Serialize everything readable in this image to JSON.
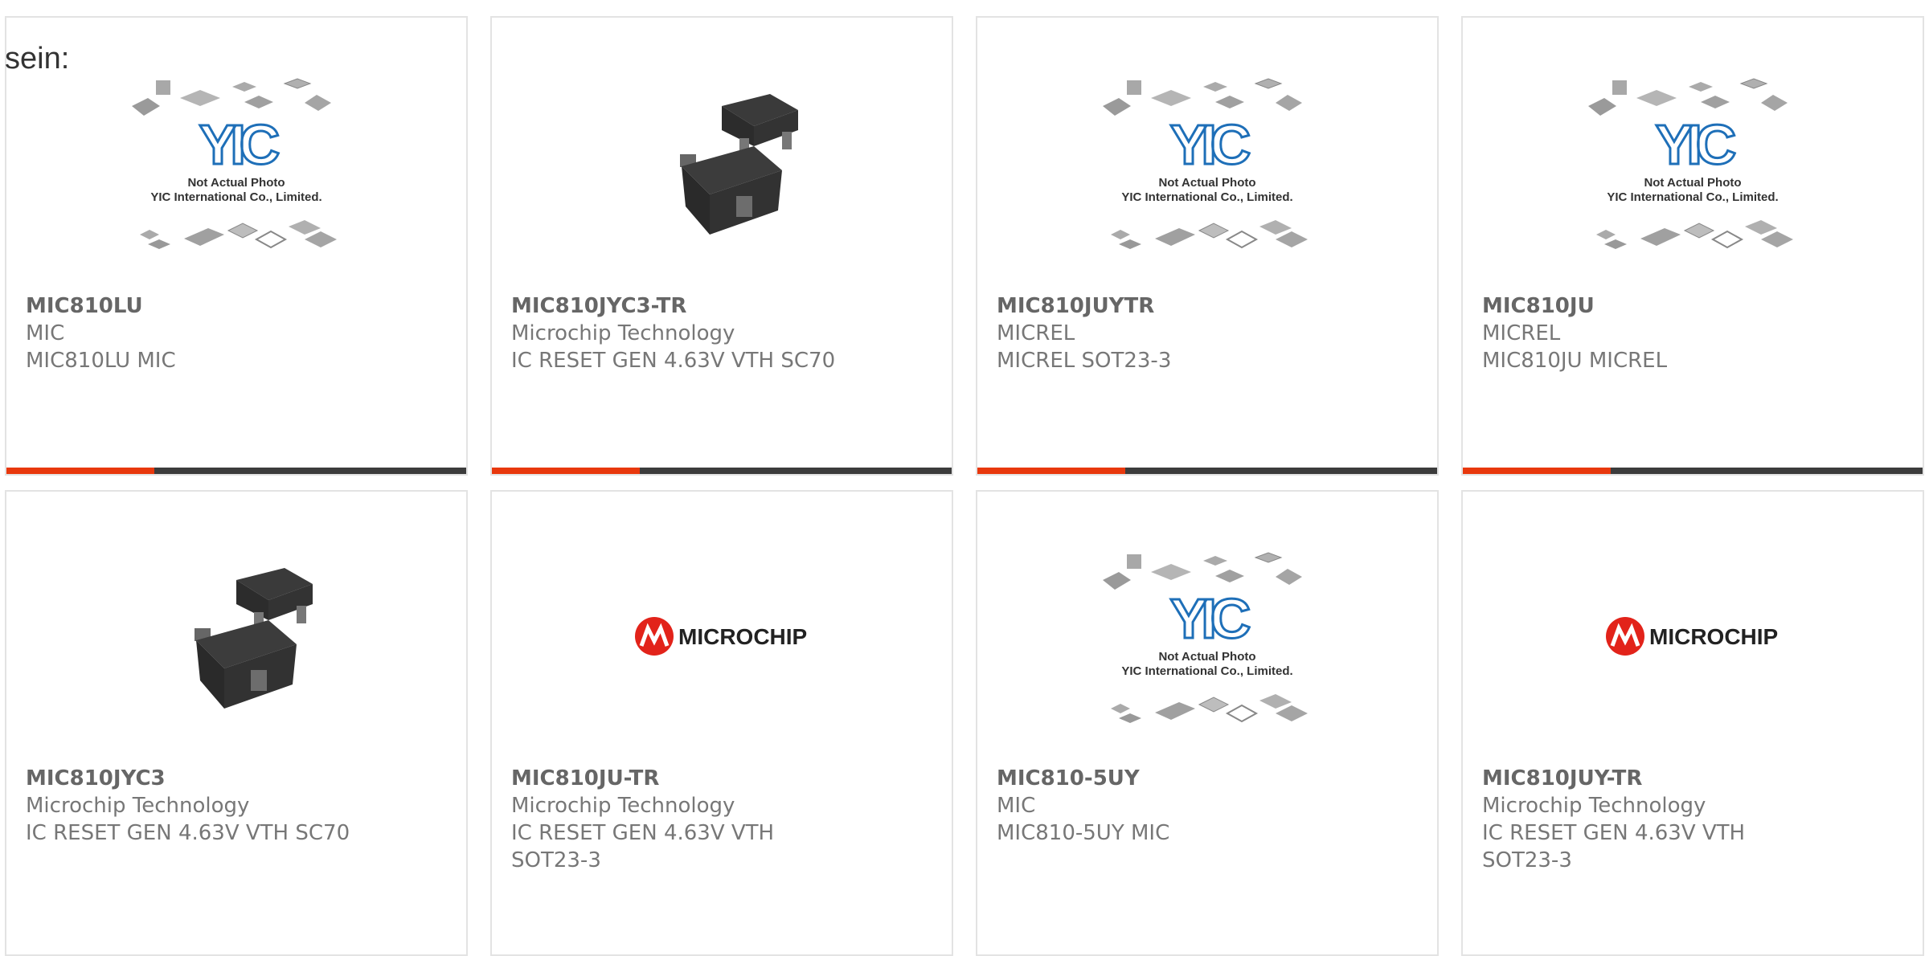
{
  "intro_text": "sein:",
  "colors": {
    "accent": "#e8380d",
    "bar": "#3c3c3c",
    "border": "#e3e3e3",
    "text": "#666666"
  },
  "placeholder": {
    "line1": "Not Actual Photo",
    "line2": "YIC International Co., Limited.",
    "logo": "YIC"
  },
  "microchip_logo_text": "MICROCHIP",
  "products": [
    {
      "part": "MIC810LU",
      "manufacturer": "MIC",
      "description": "MIC810LU MIC",
      "image": "yic-placeholder"
    },
    {
      "part": "MIC810JYC3-TR",
      "manufacturer": "Microchip Technology",
      "description": "IC RESET GEN 4.63V VTH SC70",
      "image": "sot-package-photo"
    },
    {
      "part": "MIC810JUYTR",
      "manufacturer": "MICREL",
      "description": "MICREL SOT23-3",
      "image": "yic-placeholder"
    },
    {
      "part": "MIC810JU",
      "manufacturer": "MICREL",
      "description": "MIC810JU MICREL",
      "image": "yic-placeholder"
    },
    {
      "part": "MIC810JYC3",
      "manufacturer": "Microchip Technology",
      "description": "IC RESET GEN 4.63V VTH SC70",
      "image": "sot-package-photo"
    },
    {
      "part": "MIC810JU-TR",
      "manufacturer": "Microchip Technology",
      "description": "IC RESET GEN 4.63V VTH SOT23-3",
      "image": "microchip-logo"
    },
    {
      "part": "MIC810-5UY",
      "manufacturer": "MIC",
      "description": "MIC810-5UY MIC",
      "image": "yic-placeholder"
    },
    {
      "part": "MIC810JUY-TR",
      "manufacturer": "Microchip Technology",
      "description": "IC RESET GEN 4.63V VTH SOT23-3",
      "image": "microchip-logo"
    }
  ]
}
